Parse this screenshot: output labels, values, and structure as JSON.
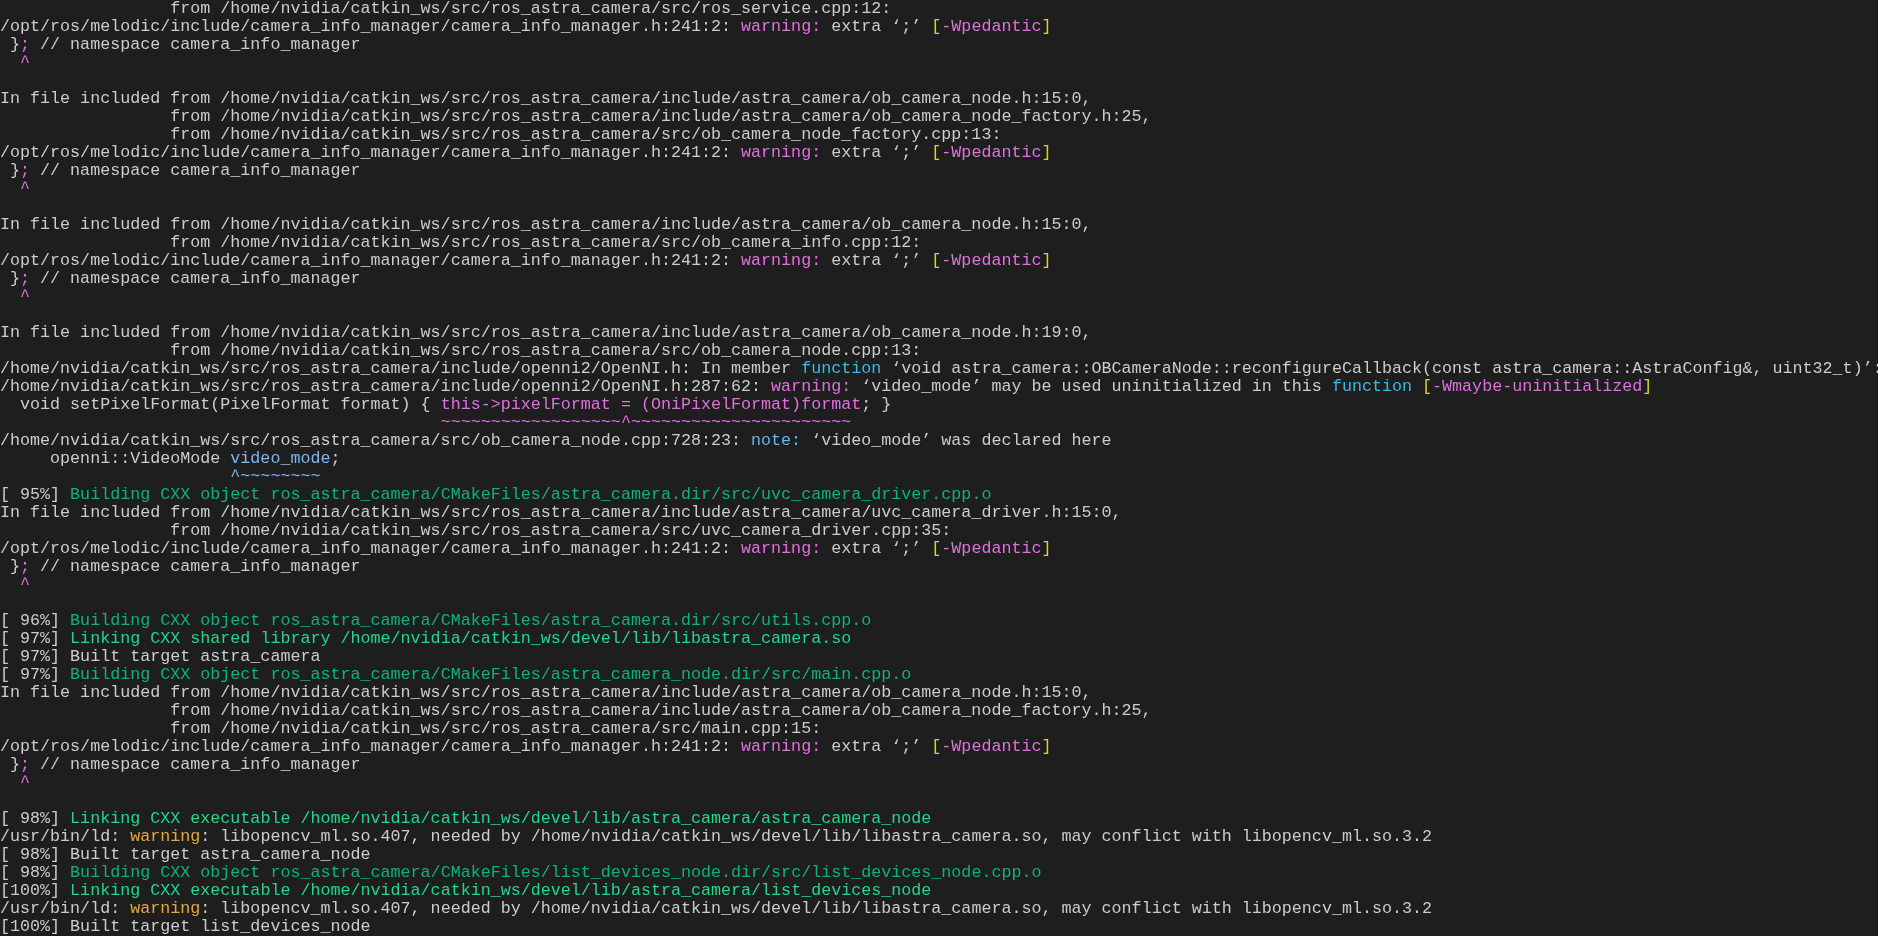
{
  "terminal": {
    "lines": [
      {
        "kind": "text",
        "segments": [
          {
            "text": "                 from /home/nvidia/catkin_ws/src/ros_astra_camera/src/ros_service.cpp:12:",
            "kind": "text"
          }
        ]
      },
      {
        "kind": "text",
        "segments": [
          {
            "text": "/opt/ros/melodic/include/camera_info_manager/camera_info_manager.h:241:2: ",
            "kind": "text"
          },
          {
            "text": "warning:",
            "kind": "warning"
          },
          {
            "text": " extra ‘;’ ",
            "kind": "text"
          },
          {
            "text": "[",
            "kind": "bracket"
          },
          {
            "text": "-Wpedantic",
            "kind": "flag"
          },
          {
            "text": "]",
            "kind": "bracket"
          }
        ]
      },
      {
        "kind": "text",
        "segments": [
          {
            "text": " }",
            "kind": "text"
          },
          {
            "text": ";",
            "kind": "caret"
          },
          {
            "text": " // namespace camera_info_manager",
            "kind": "text"
          }
        ]
      },
      {
        "kind": "text",
        "segments": [
          {
            "text": "  ^",
            "kind": "caret"
          }
        ]
      },
      {
        "kind": "blank"
      },
      {
        "kind": "text",
        "segments": [
          {
            "text": "In file included from /home/nvidia/catkin_ws/src/ros_astra_camera/include/astra_camera/ob_camera_node.h:15:0,",
            "kind": "text"
          }
        ]
      },
      {
        "kind": "text",
        "segments": [
          {
            "text": "                 from /home/nvidia/catkin_ws/src/ros_astra_camera/include/astra_camera/ob_camera_node_factory.h:25,",
            "kind": "text"
          }
        ]
      },
      {
        "kind": "text",
        "segments": [
          {
            "text": "                 from /home/nvidia/catkin_ws/src/ros_astra_camera/src/ob_camera_node_factory.cpp:13:",
            "kind": "text"
          }
        ]
      },
      {
        "kind": "text",
        "segments": [
          {
            "text": "/opt/ros/melodic/include/camera_info_manager/camera_info_manager.h:241:2: ",
            "kind": "text"
          },
          {
            "text": "warning:",
            "kind": "warning"
          },
          {
            "text": " extra ‘;’ ",
            "kind": "text"
          },
          {
            "text": "[",
            "kind": "bracket"
          },
          {
            "text": "-Wpedantic",
            "kind": "flag"
          },
          {
            "text": "]",
            "kind": "bracket"
          }
        ]
      },
      {
        "kind": "text",
        "segments": [
          {
            "text": " }",
            "kind": "text"
          },
          {
            "text": ";",
            "kind": "caret"
          },
          {
            "text": " // namespace camera_info_manager",
            "kind": "text"
          }
        ]
      },
      {
        "kind": "text",
        "segments": [
          {
            "text": "  ^",
            "kind": "caret"
          }
        ]
      },
      {
        "kind": "blank"
      },
      {
        "kind": "text",
        "segments": [
          {
            "text": "In file included from /home/nvidia/catkin_ws/src/ros_astra_camera/include/astra_camera/ob_camera_node.h:15:0,",
            "kind": "text"
          }
        ]
      },
      {
        "kind": "text",
        "segments": [
          {
            "text": "                 from /home/nvidia/catkin_ws/src/ros_astra_camera/src/ob_camera_info.cpp:12:",
            "kind": "text"
          }
        ]
      },
      {
        "kind": "text",
        "segments": [
          {
            "text": "/opt/ros/melodic/include/camera_info_manager/camera_info_manager.h:241:2: ",
            "kind": "text"
          },
          {
            "text": "warning:",
            "kind": "warning"
          },
          {
            "text": " extra ‘;’ ",
            "kind": "text"
          },
          {
            "text": "[",
            "kind": "bracket"
          },
          {
            "text": "-Wpedantic",
            "kind": "flag"
          },
          {
            "text": "]",
            "kind": "bracket"
          }
        ]
      },
      {
        "kind": "text",
        "segments": [
          {
            "text": " }",
            "kind": "text"
          },
          {
            "text": ";",
            "kind": "caret"
          },
          {
            "text": " // namespace camera_info_manager",
            "kind": "text"
          }
        ]
      },
      {
        "kind": "text",
        "segments": [
          {
            "text": "  ^",
            "kind": "caret"
          }
        ]
      },
      {
        "kind": "blank"
      },
      {
        "kind": "text",
        "segments": [
          {
            "text": "In file included from /home/nvidia/catkin_ws/src/ros_astra_camera/include/astra_camera/ob_camera_node.h:19:0,",
            "kind": "text"
          }
        ]
      },
      {
        "kind": "text",
        "segments": [
          {
            "text": "                 from /home/nvidia/catkin_ws/src/ros_astra_camera/src/ob_camera_node.cpp:13:",
            "kind": "text"
          }
        ]
      },
      {
        "kind": "text",
        "segments": [
          {
            "text": "/home/nvidia/catkin_ws/src/ros_astra_camera/include/openni2/OpenNI.h: In member ",
            "kind": "text"
          },
          {
            "text": "function",
            "kind": "keyword"
          },
          {
            "text": " ‘void astra_camera::OBCameraNode::reconfigureCallback(const astra_camera::AstraConfig&, uint32_t)’:",
            "kind": "text"
          }
        ]
      },
      {
        "kind": "text",
        "segments": [
          {
            "text": "/home/nvidia/catkin_ws/src/ros_astra_camera/include/openni2/OpenNI.h:287:62: ",
            "kind": "text"
          },
          {
            "text": "warning:",
            "kind": "warning"
          },
          {
            "text": " ‘video_mode’ may be used uninitialized in this ",
            "kind": "text"
          },
          {
            "text": "function",
            "kind": "keyword"
          },
          {
            "text": " [",
            "kind": "bracket"
          },
          {
            "text": "-Wmaybe-uninitialized",
            "kind": "flag"
          },
          {
            "text": "]",
            "kind": "bracket"
          }
        ]
      },
      {
        "kind": "text",
        "segments": [
          {
            "text": "  void setPixelFormat(PixelFormat format) { ",
            "kind": "text"
          },
          {
            "text": "this->pixelFormat = (OniPixelFormat)format",
            "kind": "caret"
          },
          {
            "text": "; }",
            "kind": "text"
          }
        ]
      },
      {
        "kind": "text",
        "segments": [
          {
            "text": "                                            ~~~~~~~~~~~~~~~~~~^~~~~~~~~~~~~~~~~~~~~~~",
            "kind": "caret"
          }
        ]
      },
      {
        "kind": "text",
        "segments": [
          {
            "text": "/home/nvidia/catkin_ws/src/ros_astra_camera/src/ob_camera_node.cpp:728:23: ",
            "kind": "text"
          },
          {
            "text": "note:",
            "kind": "note"
          },
          {
            "text": " ‘video_mode’ was declared here",
            "kind": "text"
          }
        ]
      },
      {
        "kind": "text",
        "segments": [
          {
            "text": "     openni::VideoMode ",
            "kind": "text"
          },
          {
            "text": "video_mode",
            "kind": "symbol"
          },
          {
            "text": ";",
            "kind": "text"
          }
        ]
      },
      {
        "kind": "text",
        "segments": [
          {
            "text": "                       ^~~~~~~~~",
            "kind": "symbol"
          }
        ]
      },
      {
        "kind": "text",
        "segments": [
          {
            "text": "[ 95%] ",
            "kind": "text"
          },
          {
            "text": "Building CXX object ros_astra_camera/CMakeFiles/astra_camera.dir/src/uvc_camera_driver.cpp.o",
            "kind": "build"
          }
        ]
      },
      {
        "kind": "text",
        "segments": [
          {
            "text": "In file included from /home/nvidia/catkin_ws/src/ros_astra_camera/include/astra_camera/uvc_camera_driver.h:15:0,",
            "kind": "text"
          }
        ]
      },
      {
        "kind": "text",
        "segments": [
          {
            "text": "                 from /home/nvidia/catkin_ws/src/ros_astra_camera/src/uvc_camera_driver.cpp:35:",
            "kind": "text"
          }
        ]
      },
      {
        "kind": "text",
        "segments": [
          {
            "text": "/opt/ros/melodic/include/camera_info_manager/camera_info_manager.h:241:2: ",
            "kind": "text"
          },
          {
            "text": "warning:",
            "kind": "warning"
          },
          {
            "text": " extra ‘;’ ",
            "kind": "text"
          },
          {
            "text": "[",
            "kind": "bracket"
          },
          {
            "text": "-Wpedantic",
            "kind": "flag"
          },
          {
            "text": "]",
            "kind": "bracket"
          }
        ]
      },
      {
        "kind": "text",
        "segments": [
          {
            "text": " }",
            "kind": "text"
          },
          {
            "text": ";",
            "kind": "caret"
          },
          {
            "text": " // namespace camera_info_manager",
            "kind": "text"
          }
        ]
      },
      {
        "kind": "text",
        "segments": [
          {
            "text": "  ^",
            "kind": "caret"
          }
        ]
      },
      {
        "kind": "blank"
      },
      {
        "kind": "text",
        "segments": [
          {
            "text": "[ 96%] ",
            "kind": "text"
          },
          {
            "text": "Building CXX object ros_astra_camera/CMakeFiles/astra_camera.dir/src/utils.cpp.o",
            "kind": "build"
          }
        ]
      },
      {
        "kind": "text",
        "segments": [
          {
            "text": "[ 97%] ",
            "kind": "text"
          },
          {
            "text": "Linking CXX shared library /home/nvidia/catkin_ws/devel/lib/libastra_camera.so",
            "kind": "link"
          }
        ]
      },
      {
        "kind": "text",
        "segments": [
          {
            "text": "[ 97%] Built target astra_camera",
            "kind": "text"
          }
        ]
      },
      {
        "kind": "text",
        "segments": [
          {
            "text": "[ 97%] ",
            "kind": "text"
          },
          {
            "text": "Building CXX object ros_astra_camera/CMakeFiles/astra_camera_node.dir/src/main.cpp.o",
            "kind": "build"
          }
        ]
      },
      {
        "kind": "text",
        "segments": [
          {
            "text": "In file included from /home/nvidia/catkin_ws/src/ros_astra_camera/include/astra_camera/ob_camera_node.h:15:0,",
            "kind": "text"
          }
        ]
      },
      {
        "kind": "text",
        "segments": [
          {
            "text": "                 from /home/nvidia/catkin_ws/src/ros_astra_camera/include/astra_camera/ob_camera_node_factory.h:25,",
            "kind": "text"
          }
        ]
      },
      {
        "kind": "text",
        "segments": [
          {
            "text": "                 from /home/nvidia/catkin_ws/src/ros_astra_camera/src/main.cpp:15:",
            "kind": "text"
          }
        ]
      },
      {
        "kind": "text",
        "segments": [
          {
            "text": "/opt/ros/melodic/include/camera_info_manager/camera_info_manager.h:241:2: ",
            "kind": "text"
          },
          {
            "text": "warning:",
            "kind": "warning"
          },
          {
            "text": " extra ‘;’ ",
            "kind": "text"
          },
          {
            "text": "[",
            "kind": "bracket"
          },
          {
            "text": "-Wpedantic",
            "kind": "flag"
          },
          {
            "text": "]",
            "kind": "bracket"
          }
        ]
      },
      {
        "kind": "text",
        "segments": [
          {
            "text": " }",
            "kind": "text"
          },
          {
            "text": ";",
            "kind": "caret"
          },
          {
            "text": " // namespace camera_info_manager",
            "kind": "text"
          }
        ]
      },
      {
        "kind": "text",
        "segments": [
          {
            "text": "  ^",
            "kind": "caret"
          }
        ]
      },
      {
        "kind": "blank"
      },
      {
        "kind": "text",
        "segments": [
          {
            "text": "[ 98%] ",
            "kind": "text"
          },
          {
            "text": "Linking CXX executable /home/nvidia/catkin_ws/devel/lib/astra_camera/astra_camera_node",
            "kind": "link"
          }
        ]
      },
      {
        "kind": "text",
        "segments": [
          {
            "text": "/usr/bin/ld: ",
            "kind": "text"
          },
          {
            "text": "warning",
            "kind": "ld-warning"
          },
          {
            "text": ": libopencv_ml.so.407, needed by /home/nvidia/catkin_ws/devel/lib/libastra_camera.so, may conflict with libopencv_ml.so.3.2",
            "kind": "text"
          }
        ]
      },
      {
        "kind": "text",
        "segments": [
          {
            "text": "[ 98%] Built target astra_camera_node",
            "kind": "text"
          }
        ]
      },
      {
        "kind": "text",
        "segments": [
          {
            "text": "[ 98%] ",
            "kind": "text"
          },
          {
            "text": "Building CXX object ros_astra_camera/CMakeFiles/list_devices_node.dir/src/list_devices_node.cpp.o",
            "kind": "build"
          }
        ]
      },
      {
        "kind": "text",
        "segments": [
          {
            "text": "[100%] ",
            "kind": "text"
          },
          {
            "text": "Linking CXX executable /home/nvidia/catkin_ws/devel/lib/astra_camera/list_devices_node",
            "kind": "link"
          }
        ]
      },
      {
        "kind": "text",
        "segments": [
          {
            "text": "/usr/bin/ld: ",
            "kind": "text"
          },
          {
            "text": "warning",
            "kind": "ld-warning"
          },
          {
            "text": ": libopencv_ml.so.407, needed by /home/nvidia/catkin_ws/devel/lib/libastra_camera.so, may conflict with libopencv_ml.so.3.2",
            "kind": "text"
          }
        ]
      },
      {
        "kind": "text",
        "segments": [
          {
            "text": "[100%] Built target list_devices_node",
            "kind": "text"
          }
        ]
      }
    ]
  }
}
